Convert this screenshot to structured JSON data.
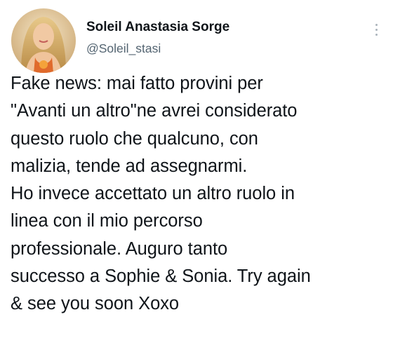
{
  "author": {
    "display_name": "Soleil Anastasia Sorge",
    "handle": "@Soleil_stasi",
    "avatar_icon": "profile-photo-avatar"
  },
  "menu": {
    "icon": "more-vertical-icon"
  },
  "tweet": {
    "lines": [
      "Fake news: mai fatto provini per",
      "\"Avanti un altro\"ne avrei considerato",
      "questo ruolo che qualcuno, con",
      "malizia, tende ad assegnarmi.",
      "Ho invece accettato un altro ruolo in",
      "linea con il mio percorso",
      "professionale. Auguro tanto",
      "successo a Sophie & Sonia. Try again",
      "& see you soon Xoxo"
    ]
  },
  "colors": {
    "text_primary": "#0f1419",
    "text_secondary": "#536471",
    "background": "#ffffff"
  }
}
